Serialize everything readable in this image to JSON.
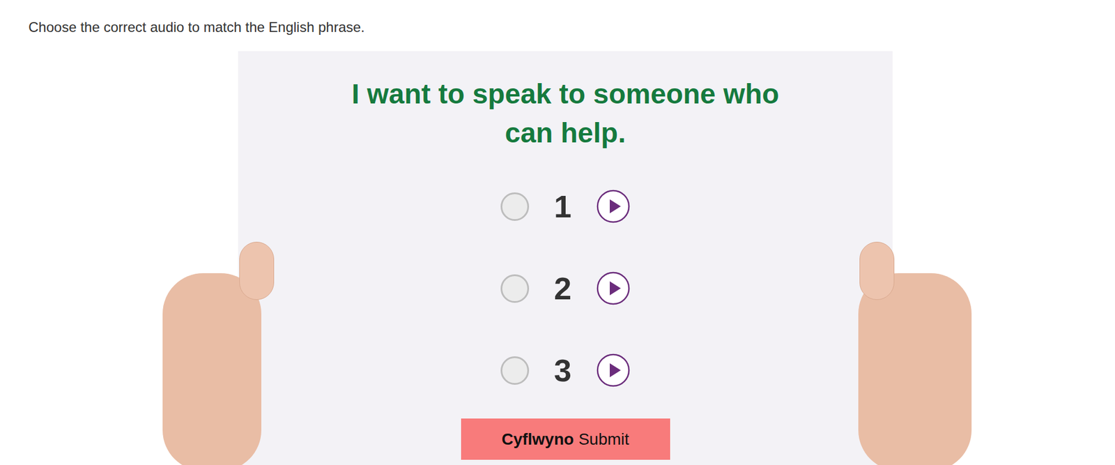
{
  "instruction": "Choose the correct audio to match the English phrase.",
  "prompt": "I want to speak to someone who can help.",
  "options": [
    {
      "label": "1",
      "selected": false
    },
    {
      "label": "2",
      "selected": false
    },
    {
      "label": "3",
      "selected": false
    }
  ],
  "submit": {
    "welsh": "Cyflwyno",
    "english": "Submit"
  }
}
